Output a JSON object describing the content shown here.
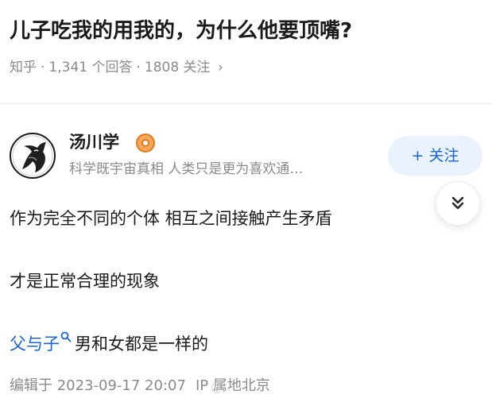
{
  "question": {
    "title": "儿子吃我的用我的，为什么他要顶嘴?",
    "source": "知乎",
    "answer_count": "1,341 个回答",
    "follower_count": "1808 关注",
    "chevron": "›"
  },
  "author": {
    "name": "汤川学",
    "bio": "科学既宇宙真相 人类只是更为喜欢通…",
    "badge_icon": "certified-badge-icon",
    "follow_label": "+ 关注"
  },
  "answer": {
    "paragraph_1": "作为完全不同的个体 相互之间接触产生矛盾",
    "paragraph_2": "才是正常合理的现象",
    "topic_link": "父与子",
    "paragraph_3_rest": "男和女都是一样的",
    "edited_label": "编辑于 2023-09-17 20:07",
    "ip_label": "IP 属地北京"
  },
  "watermark": "@...",
  "colors": {
    "accent": "#1965d8",
    "muted": "#8a8a8a",
    "follow_bg": "#eaf2fd",
    "badge": "#f6a65a"
  }
}
